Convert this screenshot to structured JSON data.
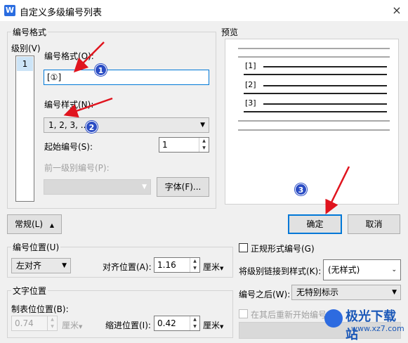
{
  "window": {
    "app_icon": "W",
    "title": "自定义多级编号列表",
    "close": "×"
  },
  "number_format_group": {
    "label": "编号格式",
    "level_label": "级别(V)",
    "levels": [
      "1"
    ],
    "format_label": "编号格式(O):",
    "format_value": "[①]",
    "style_label": "编号样式(N):",
    "style_value": "1, 2, 3, ...",
    "start_label": "起始编号(S):",
    "start_value": "1",
    "prev_level_label": "前一级别编号(P):",
    "font_button": "字体(F)..."
  },
  "preview": {
    "label": "预览",
    "items": [
      "[1]",
      "[2]",
      "[3]"
    ]
  },
  "annotations": [
    "1",
    "2",
    "3"
  ],
  "buttons": {
    "normal": "常规(L)",
    "normal_icon": "▲",
    "ok": "确定",
    "cancel": "取消"
  },
  "number_position": {
    "label": "编号位置(U)",
    "align_value": "左对齐",
    "align_pos_label": "对齐位置(A):",
    "align_pos_value": "1.16",
    "unit": "厘米"
  },
  "text_position": {
    "label": "文字位置",
    "tab_label": "制表位位置(B):",
    "tab_value": "0.74",
    "tab_unit": "厘米",
    "indent_label": "缩进位置(I):",
    "indent_value": "0.42",
    "indent_unit": "厘米"
  },
  "right_options": {
    "legal_format_label": "正规形式编号(G)",
    "link_style_label": "将级别链接到样式(K):",
    "link_style_value": "(无样式)",
    "after_number_label": "编号之后(W):",
    "after_number_value": "无特别标示",
    "restart_label": "在其后重新开始编号"
  },
  "watermark": {
    "text": "极光下载站",
    "url": "www.xz7.com"
  },
  "colors": {
    "accent": "#0078d7",
    "badge": "#2a4cc4",
    "arrow": "#e0141e"
  }
}
